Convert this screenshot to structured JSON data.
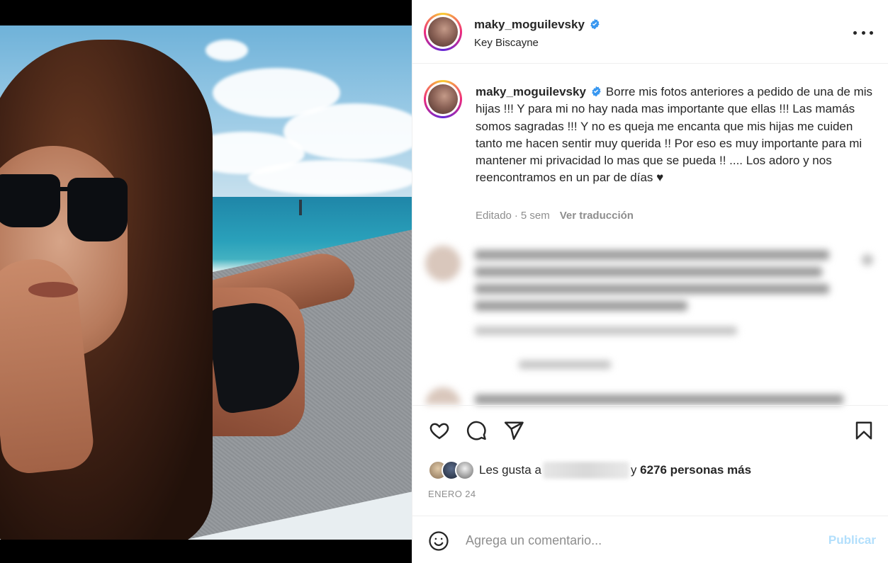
{
  "post": {
    "username": "maky_moguilevsky",
    "location": "Key Biscayne",
    "verified": true,
    "more_icon": "more-horizontal-icon"
  },
  "caption": {
    "username": "maky_moguilevsky",
    "text": "Borre mis fotos anteriores a pedido de una de mis hijas !!! Y para mi no hay nada mas importante que ellas !!! Las mamás somos sagradas !!! Y no es queja me encanta que mis hijas me cuiden tanto me hacen sentir muy querida !! Por eso es muy importante para mi mantener mi privacidad lo mas que se pueda !! .... Los adoro y nos reencontramos en un par de días ♥",
    "edited_label": "Editado",
    "time_ago": "5 sem",
    "translate_label": "Ver traducción"
  },
  "actions": {
    "like_icon": "heart-icon",
    "comment_icon": "comment-icon",
    "share_icon": "send-icon",
    "save_icon": "bookmark-icon"
  },
  "likes": {
    "prefix": "Les gusta a",
    "connector": "y",
    "count_text": "6276 personas más"
  },
  "date": "ENERO 24",
  "composer": {
    "emoji_icon": "emoji-smile-icon",
    "placeholder": "Agrega un comentario...",
    "publish_label": "Publicar"
  },
  "colors": {
    "verified_blue": "#3897f0",
    "text_primary": "#262626",
    "text_secondary": "#8e8e8e",
    "publish_disabled": "#b2dffc",
    "divider": "#efefef"
  }
}
